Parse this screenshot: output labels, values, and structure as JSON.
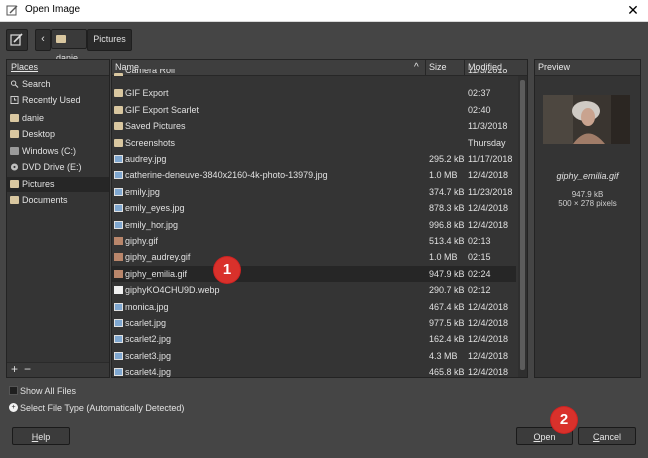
{
  "window": {
    "title": "Open Image",
    "close_glyph": "✕"
  },
  "breadcrumb": {
    "back_glyph": "‹",
    "items": [
      "danie",
      "Pictures"
    ]
  },
  "places": {
    "header": "Places",
    "items": [
      {
        "label": "Search",
        "icon": "search-icon"
      },
      {
        "label": "Recently Used",
        "icon": "clock-icon"
      },
      {
        "label": "danie",
        "icon": "folder-icon"
      },
      {
        "label": "Desktop",
        "icon": "folder-icon"
      },
      {
        "label": "Windows (C:)",
        "icon": "drive-icon"
      },
      {
        "label": "DVD Drive (E:)",
        "icon": "dvd-icon"
      },
      {
        "label": "Pictures",
        "icon": "folder-icon",
        "selected": true
      },
      {
        "label": "Documents",
        "icon": "folder-icon"
      }
    ],
    "add_glyph": "+",
    "remove_glyph": "−"
  },
  "files": {
    "columns": {
      "name": "Name",
      "size": "Size",
      "modified": "Modified"
    },
    "sort_glyph": "^",
    "rows": [
      {
        "name": "Camera Roll",
        "size": "",
        "modified": "11/3/2018",
        "type": "folder"
      },
      {
        "name": "GIF Export",
        "size": "",
        "modified": "02:37",
        "type": "folder"
      },
      {
        "name": "GIF Export Scarlet",
        "size": "",
        "modified": "02:40",
        "type": "folder"
      },
      {
        "name": "Saved Pictures",
        "size": "",
        "modified": "11/3/2018",
        "type": "folder"
      },
      {
        "name": "Screenshots",
        "size": "",
        "modified": "Thursday",
        "type": "folder"
      },
      {
        "name": "audrey.jpg",
        "size": "295.2 kB",
        "modified": "11/17/2018",
        "type": "image"
      },
      {
        "name": "catherine-deneuve-3840x2160-4k-photo-13979.jpg",
        "size": "1.0 MB",
        "modified": "12/4/2018",
        "type": "image"
      },
      {
        "name": "emily.jpg",
        "size": "374.7 kB",
        "modified": "11/23/2018",
        "type": "image"
      },
      {
        "name": "emily_eyes.jpg",
        "size": "878.3 kB",
        "modified": "12/4/2018",
        "type": "image"
      },
      {
        "name": "emily_hor.jpg",
        "size": "996.8 kB",
        "modified": "12/4/2018",
        "type": "image"
      },
      {
        "name": "giphy.gif",
        "size": "513.4 kB",
        "modified": "02:13",
        "type": "gif"
      },
      {
        "name": "giphy_audrey.gif",
        "size": "1.0 MB",
        "modified": "02:15",
        "type": "gif"
      },
      {
        "name": "giphy_emilia.gif",
        "size": "947.9 kB",
        "modified": "02:24",
        "type": "gif",
        "selected": true
      },
      {
        "name": "giphyKO4CHU9D.webp",
        "size": "290.7 kB",
        "modified": "02:12",
        "type": "doc"
      },
      {
        "name": "monica.jpg",
        "size": "467.4 kB",
        "modified": "12/4/2018",
        "type": "image"
      },
      {
        "name": "scarlet.jpg",
        "size": "977.5 kB",
        "modified": "12/4/2018",
        "type": "image"
      },
      {
        "name": "scarlet2.jpg",
        "size": "162.4 kB",
        "modified": "12/4/2018",
        "type": "image"
      },
      {
        "name": "scarlet3.jpg",
        "size": "4.3 MB",
        "modified": "12/4/2018",
        "type": "image"
      },
      {
        "name": "scarlet4.jpg",
        "size": "465.8 kB",
        "modified": "12/4/2018",
        "type": "image"
      }
    ]
  },
  "preview": {
    "header": "Preview",
    "filename": "giphy_emilia.gif",
    "size": "947.9 kB",
    "dimensions": "500 × 278 pixels"
  },
  "options": {
    "show_all_files": "Show All Files",
    "select_file_type": "Select File Type (Automatically Detected)",
    "expander_glyph": "+"
  },
  "buttons": {
    "help_mnemonic": "H",
    "help_rest": "elp",
    "open_mnemonic": "O",
    "open_rest": "pen",
    "cancel_mnemonic": "C",
    "cancel_rest": "ancel"
  },
  "annotations": {
    "step1": "1",
    "step2": "2"
  },
  "colors": {
    "badge": "#d9312b",
    "dialog_bg": "#454545",
    "panel_bg": "#343434",
    "selected_row": "#262626"
  }
}
